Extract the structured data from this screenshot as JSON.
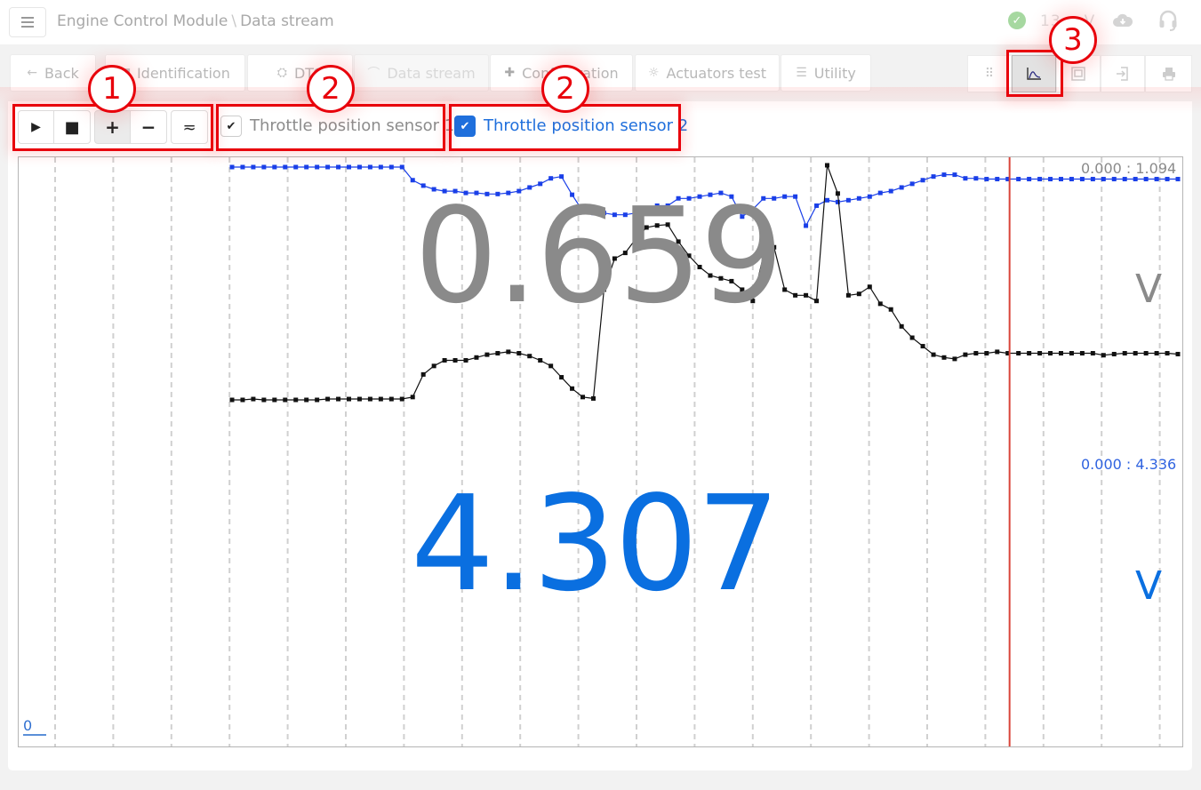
{
  "header": {
    "breadcrumb": [
      "Engine Control Module",
      "Data stream"
    ],
    "breadcrumb_sep": "\\",
    "status_icon": "check-circle-icon",
    "voltage_visible_prefix": "13",
    "voltage_visible_suffix": "V",
    "icons": [
      "menu-icon",
      "cloud-download-icon",
      "headset-icon"
    ]
  },
  "nav": {
    "back": "Back",
    "tabs": [
      {
        "label": "Identification",
        "icon": "id-card-icon",
        "disabled": false
      },
      {
        "label": "DTC",
        "icon": "engine-icon",
        "disabled": false
      },
      {
        "label": "Data stream",
        "icon": "chart-line-icon",
        "disabled": true
      },
      {
        "label": "Configuration",
        "icon": "puzzle-icon",
        "disabled": false
      },
      {
        "label": "Actuators test",
        "icon": "lightbulb-icon",
        "disabled": false
      },
      {
        "label": "Utility",
        "icon": "sliders-icon",
        "disabled": false
      }
    ],
    "view_buttons": [
      {
        "name": "grid-view",
        "icon": "grid-icon",
        "active": false
      },
      {
        "name": "chart-view",
        "icon": "chart-line-icon",
        "active": true
      },
      {
        "name": "fullscreen",
        "icon": "fullscreen-icon",
        "active": false
      },
      {
        "name": "export",
        "icon": "file-import-icon",
        "active": false
      },
      {
        "name": "print",
        "icon": "print-icon",
        "active": false
      }
    ]
  },
  "controls": {
    "play": "▶",
    "stop": "■",
    "zoom_in": "+",
    "zoom_out": "−",
    "smooth": "≂",
    "zoom_in_active": true
  },
  "sensors": [
    {
      "label": "Throttle position sensor 1",
      "checked": false,
      "check_glyph": "✔",
      "color": "#888888"
    },
    {
      "label": "Throttle position sensor 2",
      "checked": true,
      "check_glyph": "✔",
      "color": "#1f6fdc"
    }
  ],
  "chart_data": {
    "type": "line",
    "title": "",
    "xlabel": "",
    "ylabel": "",
    "x_origin_label": "0",
    "grid": "vertical-dashed",
    "cursor_position_fraction": 0.851,
    "series": [
      {
        "name": "Throttle position sensor 1",
        "color": "#111111",
        "current_value": "0.659",
        "unit": "V",
        "range_label": "0.000 : 1.094",
        "ylim": [
          0,
          1.094
        ],
        "values": [
          0.25,
          0.25,
          0.253,
          0.25,
          0.25,
          0.25,
          0.25,
          0.25,
          0.25,
          0.253,
          0.253,
          0.253,
          0.253,
          0.253,
          0.253,
          0.253,
          0.253,
          0.26,
          0.34,
          0.37,
          0.39,
          0.39,
          0.39,
          0.4,
          0.41,
          0.415,
          0.42,
          0.415,
          0.405,
          0.39,
          0.37,
          0.33,
          0.29,
          0.26,
          0.255,
          0.64,
          0.75,
          0.77,
          0.82,
          0.86,
          0.867,
          0.87,
          0.81,
          0.76,
          0.72,
          0.69,
          0.68,
          0.67,
          0.64,
          0.6,
          0.76,
          0.79,
          0.64,
          0.62,
          0.62,
          0.6,
          1.08,
          0.98,
          0.62,
          0.625,
          0.65,
          0.59,
          0.57,
          0.51,
          0.47,
          0.44,
          0.41,
          0.4,
          0.395,
          0.41,
          0.415,
          0.415,
          0.42,
          0.415,
          0.415,
          0.415,
          0.415,
          0.415,
          0.415,
          0.415,
          0.415,
          0.415,
          0.408,
          0.412,
          0.415,
          0.415,
          0.415,
          0.415,
          0.415,
          0.412
        ],
        "marker": "square"
      },
      {
        "name": "Throttle position sensor 2",
        "color": "#1a3fe8",
        "current_value": "4.307",
        "unit": "V",
        "range_label": "0.000 : 4.336",
        "ylim": [
          0,
          4.336
        ],
        "values": [
          4.336,
          4.336,
          4.336,
          4.336,
          4.336,
          4.336,
          4.336,
          4.336,
          4.336,
          4.336,
          4.336,
          4.336,
          4.336,
          4.336,
          4.336,
          4.336,
          4.336,
          4.3,
          4.285,
          4.275,
          4.27,
          4.27,
          4.265,
          4.265,
          4.262,
          4.262,
          4.265,
          4.27,
          4.28,
          4.29,
          4.305,
          4.31,
          4.26,
          4.215,
          4.21,
          4.21,
          4.205,
          4.205,
          4.21,
          4.215,
          4.23,
          4.23,
          4.25,
          4.25,
          4.255,
          4.26,
          4.265,
          4.255,
          4.2,
          4.22,
          4.25,
          4.25,
          4.255,
          4.255,
          4.175,
          4.23,
          4.245,
          4.24,
          4.245,
          4.25,
          4.255,
          4.265,
          4.27,
          4.28,
          4.29,
          4.3,
          4.31,
          4.315,
          4.315,
          4.305,
          4.305,
          4.303,
          4.303,
          4.303,
          4.303,
          4.303,
          4.303,
          4.303,
          4.303,
          4.303,
          4.303,
          4.303,
          4.303,
          4.303,
          4.303,
          4.303,
          4.303,
          4.303,
          4.303,
          4.303
        ],
        "marker": "square"
      }
    ]
  },
  "annotations": [
    {
      "number": "1",
      "target": "playback-controls"
    },
    {
      "number": "2",
      "target": "sensor-1-toggle"
    },
    {
      "number": "2",
      "target": "sensor-2-toggle"
    },
    {
      "number": "3",
      "target": "chart-view-button"
    }
  ]
}
